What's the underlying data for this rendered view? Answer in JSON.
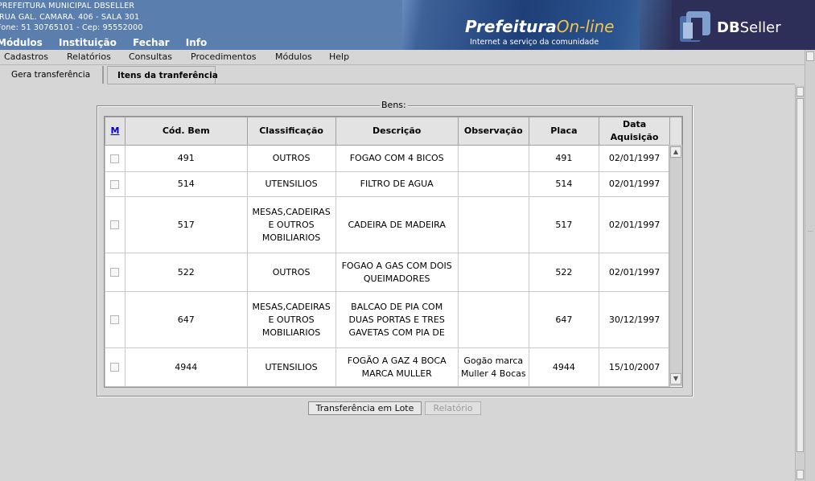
{
  "header": {
    "info_lines": [
      "PREFEITURA MUNICIPAL DBSELLER",
      "RUA GAL. CAMARA. 406 - SALA 301",
      "Fone: 51 30765101  - Cep: 95552000"
    ],
    "top_menu": [
      "Módulos",
      "Instituição",
      "Fechar",
      "Info"
    ],
    "logo_prefeitura": "Prefeitura",
    "logo_online": "On-line",
    "tagline": "Internet a serviço da comunidade",
    "logo_db": "DB",
    "logo_seller": "Seller"
  },
  "menubar": [
    "Cadastros",
    "Relatórios",
    "Consultas",
    "Procedimentos",
    "Módulos",
    "Help"
  ],
  "tabs": [
    {
      "label": "Gera transferência",
      "active": false
    },
    {
      "label": "Itens da tranferência",
      "active": true
    }
  ],
  "fieldset_legend": "Bens:",
  "grid": {
    "columns": [
      "M",
      "Cód. Bem",
      "Classificação",
      "Descrição",
      "Observação",
      "Placa",
      "Data Aquisição"
    ],
    "rows": [
      {
        "cod": "491",
        "classificacao": "OUTROS",
        "descricao": "FOGAO COM 4 BICOS",
        "observacao": "",
        "placa": "491",
        "data": "02/01/1997"
      },
      {
        "cod": "514",
        "classificacao": "UTENSILIOS",
        "descricao": "FILTRO DE AGUA",
        "observacao": "",
        "placa": "514",
        "data": "02/01/1997"
      },
      {
        "cod": "517",
        "classificacao": "MESAS,CADEIRAS E OUTROS MOBILIARIOS",
        "descricao": "CADEIRA DE MADEIRA",
        "observacao": "",
        "placa": "517",
        "data": "02/01/1997"
      },
      {
        "cod": "522",
        "classificacao": "OUTROS",
        "descricao": "FOGAO A GAS COM DOIS QUEIMADORES",
        "observacao": "",
        "placa": "522",
        "data": "02/01/1997"
      },
      {
        "cod": "647",
        "classificacao": "MESAS,CADEIRAS E OUTROS MOBILIARIOS",
        "descricao": "BALCAO DE PIA COM DUAS PORTAS E TRES GAVETAS COM PIA DE",
        "observacao": "",
        "placa": "647",
        "data": "30/12/1997"
      },
      {
        "cod": "4944",
        "classificacao": "UTENSILIOS",
        "descricao": "FOGÃO A GAZ 4 BOCA MARCA MULLER",
        "observacao": "Gogão marca Muller 4 Bocas",
        "placa": "4944",
        "data": "15/10/2007"
      }
    ]
  },
  "buttons": {
    "transferencia_lote": "Transferência em Lote",
    "relatorio": "Relatório"
  }
}
